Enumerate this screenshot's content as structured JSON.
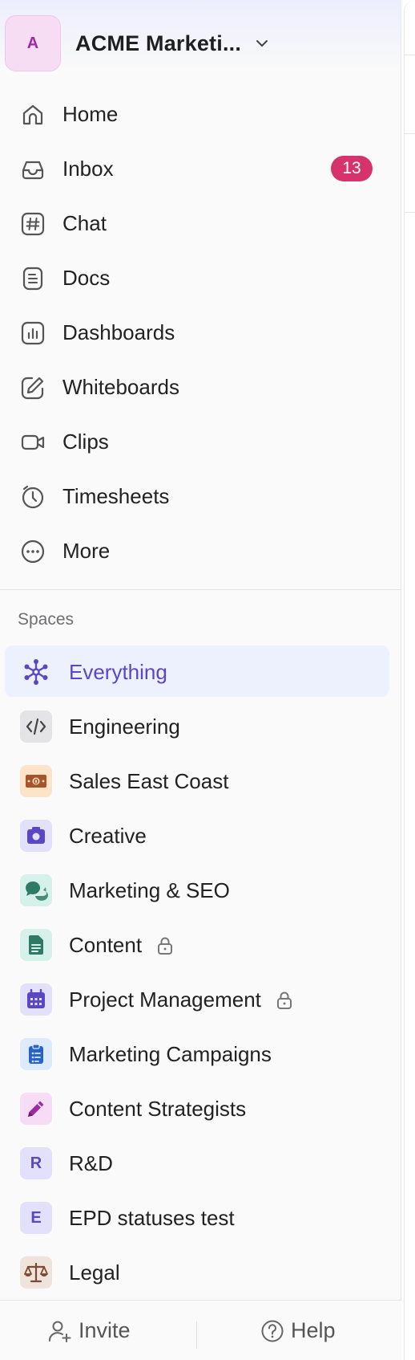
{
  "workspace": {
    "avatar_letter": "A",
    "name": "ACME Marketi..."
  },
  "nav": [
    {
      "id": "home",
      "label": "Home",
      "icon": "home-icon"
    },
    {
      "id": "inbox",
      "label": "Inbox",
      "icon": "inbox-icon",
      "badge": "13"
    },
    {
      "id": "chat",
      "label": "Chat",
      "icon": "hash-icon"
    },
    {
      "id": "docs",
      "label": "Docs",
      "icon": "doc-icon"
    },
    {
      "id": "dashboards",
      "label": "Dashboards",
      "icon": "bar-chart-icon"
    },
    {
      "id": "whiteboards",
      "label": "Whiteboards",
      "icon": "pen-square-icon"
    },
    {
      "id": "clips",
      "label": "Clips",
      "icon": "video-icon"
    },
    {
      "id": "timesheets",
      "label": "Timesheets",
      "icon": "clock-icon"
    },
    {
      "id": "more",
      "label": "More",
      "icon": "more-icon"
    }
  ],
  "spaces": {
    "heading": "Spaces",
    "items": [
      {
        "label": "Everything",
        "icon": "everything-icon",
        "active": true
      },
      {
        "label": "Engineering",
        "icon": "code-icon"
      },
      {
        "label": "Sales East Coast",
        "icon": "money-icon"
      },
      {
        "label": "Creative",
        "icon": "camera-icon"
      },
      {
        "label": "Marketing & SEO",
        "icon": "chat-bubbles-icon"
      },
      {
        "label": "Content",
        "icon": "document-icon",
        "locked": true
      },
      {
        "label": "Project Management",
        "icon": "calendar-icon",
        "locked": true
      },
      {
        "label": "Marketing Campaigns",
        "icon": "clipboard-icon"
      },
      {
        "label": "Content Strategists",
        "icon": "pencil-icon"
      },
      {
        "label": "R&D",
        "icon": "letter-avatar",
        "letter": "R"
      },
      {
        "label": "EPD statuses test",
        "icon": "letter-avatar",
        "letter": "E"
      },
      {
        "label": "Legal",
        "icon": "scale-icon"
      }
    ]
  },
  "footer": {
    "invite_label": "Invite",
    "help_label": "Help"
  },
  "colors": {
    "accent": "#5b47c4",
    "badge": "#d6336c",
    "active_bg": "#edf0fd"
  }
}
